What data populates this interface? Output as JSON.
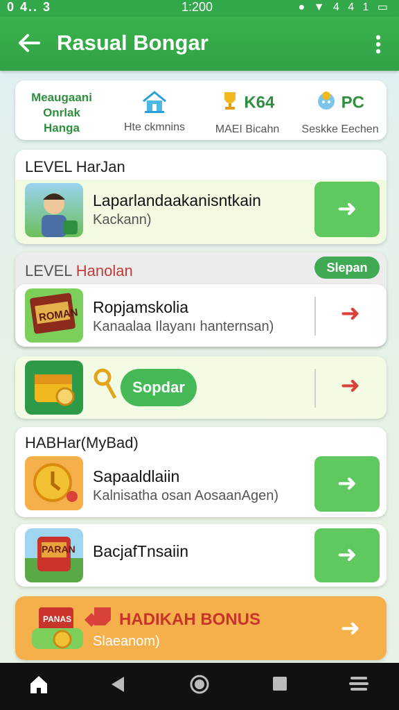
{
  "status_bar": {
    "left": "0 4.. 3",
    "time": "1:200",
    "right": "● ▼ 4 4 1 ▭"
  },
  "app_bar": {
    "title": "Rasual Bongar"
  },
  "stats": [
    {
      "text": "Meaugaani\nOnrlak\nHanga"
    },
    {
      "icon": "house-icon",
      "label": "Hte ckmnins"
    },
    {
      "icon": "trophy-icon",
      "value": "K64",
      "label": "MAEI Bicahn"
    },
    {
      "icon": "badge-icon",
      "value": "PC",
      "label": "Seskke Eechen"
    }
  ],
  "section1": {
    "title": "LEVEL HarJan"
  },
  "row1": {
    "title": "Laparlandaakanisntkain",
    "sub": "Kackann)"
  },
  "section2": {
    "title_prefix": "LEVEL ",
    "title_accent": "Hanolan",
    "pill": "Slepan"
  },
  "row2": {
    "title": "Ropjamskolia",
    "sub": "Kanaalaa Ilayanı hanternsan)",
    "thumb_text": "ROMAN"
  },
  "row3": {
    "pill": "Sopdar"
  },
  "section3": {
    "title": "HABHar(MyBad)"
  },
  "row4": {
    "title": "Sapaaldlaiin",
    "sub": "Kalnisatha osan AosaanAgen)"
  },
  "row5": {
    "title": "BacjafTnsaiin",
    "thumb_text": "PARAN"
  },
  "bonus": {
    "title": "HADIKAH BONUS",
    "sub": "Slaeanom)",
    "thumb_text": "PANAS"
  },
  "colors": {
    "primary": "#33a84a",
    "button": "#5fc95f",
    "bonus": "#f6b04b",
    "accent_red": "#d8423a"
  }
}
